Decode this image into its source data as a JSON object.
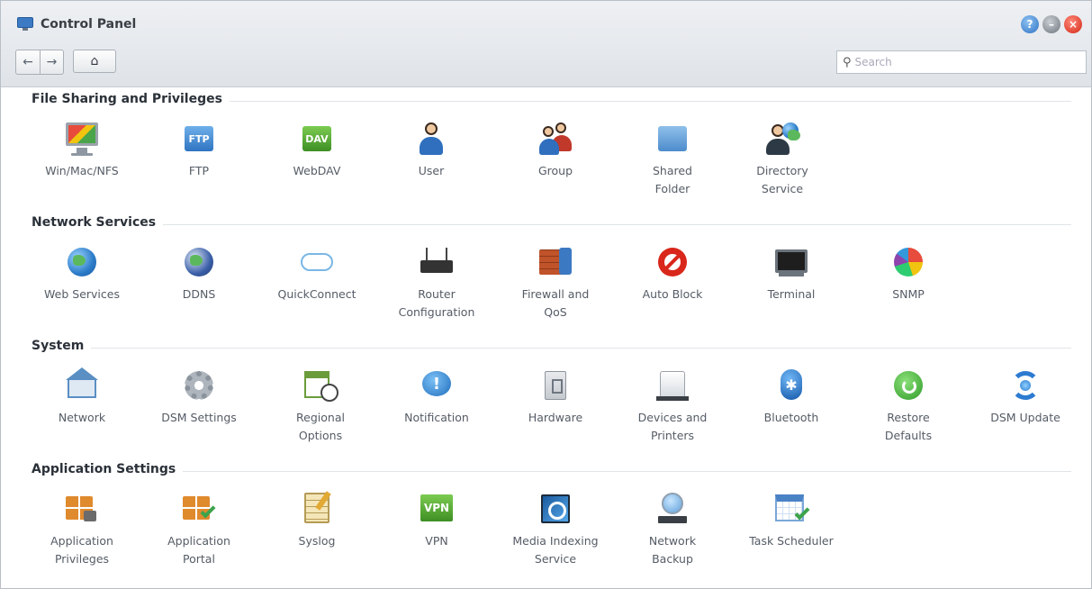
{
  "window": {
    "title": "Control Panel",
    "buttons": {
      "help": "?",
      "minimize": "–",
      "close": "×"
    }
  },
  "toolbar": {
    "back_icon": "arrow-left-icon",
    "forward_icon": "arrow-right-icon",
    "home_icon": "home-icon"
  },
  "search": {
    "placeholder": "Search"
  },
  "sections": [
    {
      "title": "File Sharing and Privileges",
      "items": [
        {
          "label": "Win/Mac/NFS",
          "icon": "monitor-icon"
        },
        {
          "label": "FTP",
          "icon": "ftp-icon"
        },
        {
          "label": "WebDAV",
          "icon": "webdav-icon"
        },
        {
          "label": "User",
          "icon": "user-icon"
        },
        {
          "label": "Group",
          "icon": "group-icon"
        },
        {
          "label": "Shared\nFolder",
          "icon": "shared-folder-icon"
        },
        {
          "label": "Directory\nService",
          "icon": "directory-service-icon"
        }
      ]
    },
    {
      "title": "Network Services",
      "items": [
        {
          "label": "Web Services",
          "icon": "globe-icon"
        },
        {
          "label": "DDNS",
          "icon": "ddns-icon"
        },
        {
          "label": "QuickConnect",
          "icon": "cloud-icon"
        },
        {
          "label": "Router\nConfiguration",
          "icon": "router-icon"
        },
        {
          "label": "Firewall and\nQoS",
          "icon": "firewall-icon"
        },
        {
          "label": "Auto Block",
          "icon": "block-icon"
        },
        {
          "label": "Terminal",
          "icon": "terminal-icon"
        },
        {
          "label": "SNMP",
          "icon": "snmp-icon"
        }
      ]
    },
    {
      "title": "System",
      "items": [
        {
          "label": "Network",
          "icon": "house-icon"
        },
        {
          "label": "DSM Settings",
          "icon": "gear-icon"
        },
        {
          "label": "Regional\nOptions",
          "icon": "regional-options-icon"
        },
        {
          "label": "Notification",
          "icon": "notification-icon"
        },
        {
          "label": "Hardware",
          "icon": "hardware-icon"
        },
        {
          "label": "Devices and\nPrinters",
          "icon": "devices-icon"
        },
        {
          "label": "Bluetooth",
          "icon": "bluetooth-icon"
        },
        {
          "label": "Restore\nDefaults",
          "icon": "restore-icon"
        },
        {
          "label": "DSM Update",
          "icon": "update-icon"
        }
      ]
    },
    {
      "title": "Application Settings",
      "items": [
        {
          "label": "Application\nPrivileges",
          "icon": "app-privileges-icon"
        },
        {
          "label": "Application\nPortal",
          "icon": "app-portal-icon"
        },
        {
          "label": "Syslog",
          "icon": "syslog-icon"
        },
        {
          "label": "VPN",
          "icon": "vpn-icon"
        },
        {
          "label": "Media Indexing\nService",
          "icon": "media-indexing-icon"
        },
        {
          "label": "Network\nBackup",
          "icon": "network-backup-icon"
        },
        {
          "label": "Task Scheduler",
          "icon": "task-scheduler-icon"
        }
      ]
    }
  ],
  "icon_text": {
    "ftp": "FTP",
    "webdav": "DAV",
    "vpn": "VPN",
    "notification": "!",
    "bluetooth": "✱"
  },
  "colors": {
    "accent": "#2e72c4",
    "close": "#d22614",
    "title_text": "#3a3f45"
  }
}
